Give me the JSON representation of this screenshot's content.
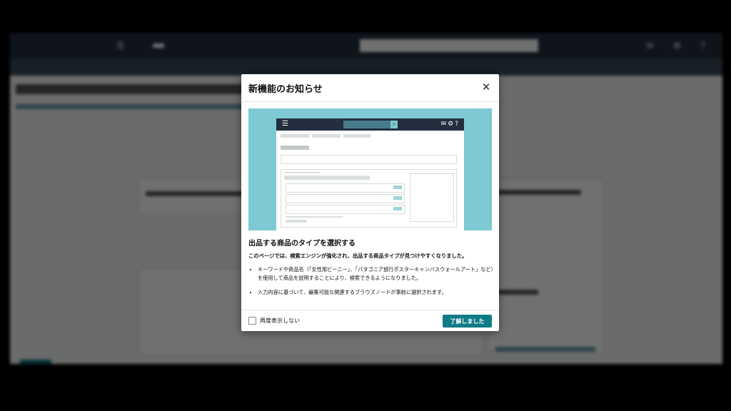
{
  "modal": {
    "title": "新機能のお知らせ",
    "close_icon": "close-icon",
    "section_title": "出品する商品のタイプを選択する",
    "description": "このページでは、検索エンジンが強化され、出品する商品タイプが見つけやすくなりました。",
    "bullets": [
      "キーワードや商品名（「女性用ビーニー」、「パタゴニア旅行ポスターキャンバスウォールアート」など）を使用して商品を説明することにより、検索できるようになりました。",
      "入力内容に基づいて、編集可能な関連するブラウズノードが事前に選択されます。"
    ],
    "checkbox_label": "再度表示しない",
    "checkbox_checked": false,
    "ok_label": "了解しました"
  },
  "preview_icons": {
    "menu": "hamburger-menu-icon",
    "search": "search-icon",
    "mail": "mail-icon",
    "settings": "gear-icon",
    "help": "help-icon"
  },
  "colors": {
    "preview_bg": "#7ec9d3",
    "header_bar": "#232f3e",
    "primary_button": "#0e7c86"
  }
}
